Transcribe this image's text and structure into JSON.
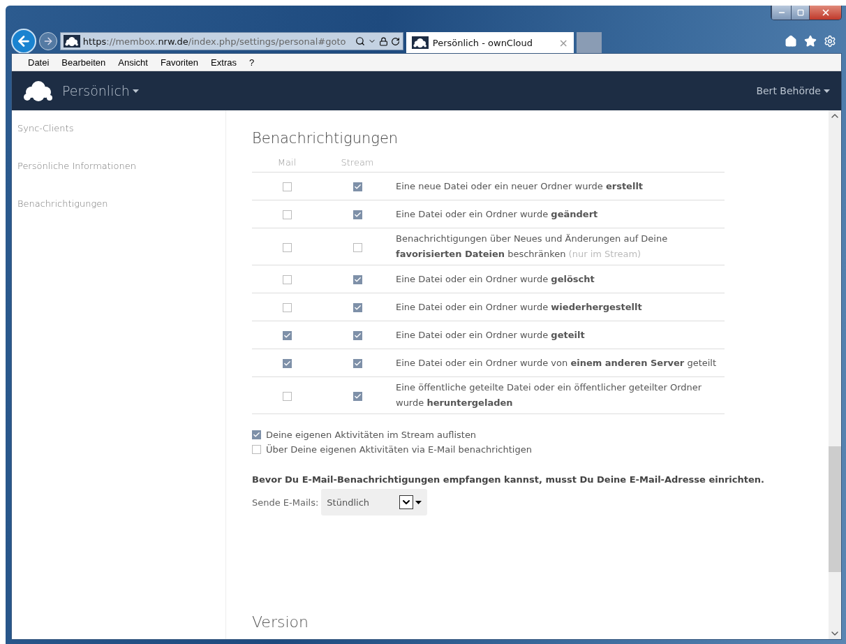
{
  "browser": {
    "url": [
      {
        "text": "https",
        "strong": true
      },
      {
        "text": "://membox.",
        "strong": false
      },
      {
        "text": "nrw.de",
        "strong": true
      },
      {
        "text": "/index.php/settings/personal#goto",
        "strong": false
      }
    ],
    "tabs": [
      {
        "title": "Persönlich - ownCloud",
        "selected": true,
        "close": "×"
      }
    ],
    "menu": [
      {
        "label": "Datei"
      },
      {
        "label": "Bearbeiten"
      },
      {
        "label": "Ansicht"
      },
      {
        "label": "Favoriten"
      },
      {
        "label": "Extras"
      },
      {
        "label": "?"
      }
    ]
  },
  "header": {
    "app": "Persönlich",
    "user": "Bert Behörde"
  },
  "sidebar": {
    "items": [
      {
        "label": "Sync-Clients"
      },
      {
        "label": "Persönliche Informationen"
      },
      {
        "label": "Benachrichtigungen"
      }
    ]
  },
  "section": {
    "title": "Benachrichtigungen",
    "columns": [
      "Mail",
      "Stream"
    ],
    "rows": [
      {
        "mail": false,
        "stream": true,
        "text": "Eine neue Datei oder ein neuer Ordner wurde **erstellt**"
      },
      {
        "mail": false,
        "stream": true,
        "text": "Eine Datei oder ein Ordner wurde **geändert**"
      },
      {
        "mail": false,
        "stream": false,
        "text": "Benachrichtigungen über Neues und Änderungen auf Deine **favorisierten Dateien** beschränken",
        "note": "(nur im Stream)"
      },
      {
        "mail": false,
        "stream": true,
        "text": "Eine Datei oder ein Ordner wurde **gelöscht**"
      },
      {
        "mail": false,
        "stream": true,
        "text": "Eine Datei oder ein Ordner wurde **wiederhergestellt**"
      },
      {
        "mail": true,
        "stream": true,
        "text": "Eine Datei oder ein Ordner wurde **geteilt**"
      },
      {
        "mail": true,
        "stream": true,
        "text": "Eine Datei oder ein Ordner wurde von **einem anderen Server** geteilt"
      },
      {
        "mail": false,
        "stream": true,
        "text": "Eine öffentliche geteilte Datei oder ein öffentlicher geteilter Ordner wurde **heruntergeladen**"
      }
    ],
    "options": [
      {
        "label": "Deine eigenen Aktivitäten im Stream auflisten",
        "checked": true
      },
      {
        "label": "Über Deine eigenen Aktivitäten via E-Mail benachrichtigen",
        "checked": false
      }
    ],
    "warning": "Bevor Du E-Mail-Benachrichtigungen empfangen kannst, musst Du Deine E-Mail-Adresse einrichten.",
    "send": {
      "label": "Sende E-Mails:",
      "value": "Stündlich"
    }
  },
  "next_section": {
    "title": "Version"
  }
}
